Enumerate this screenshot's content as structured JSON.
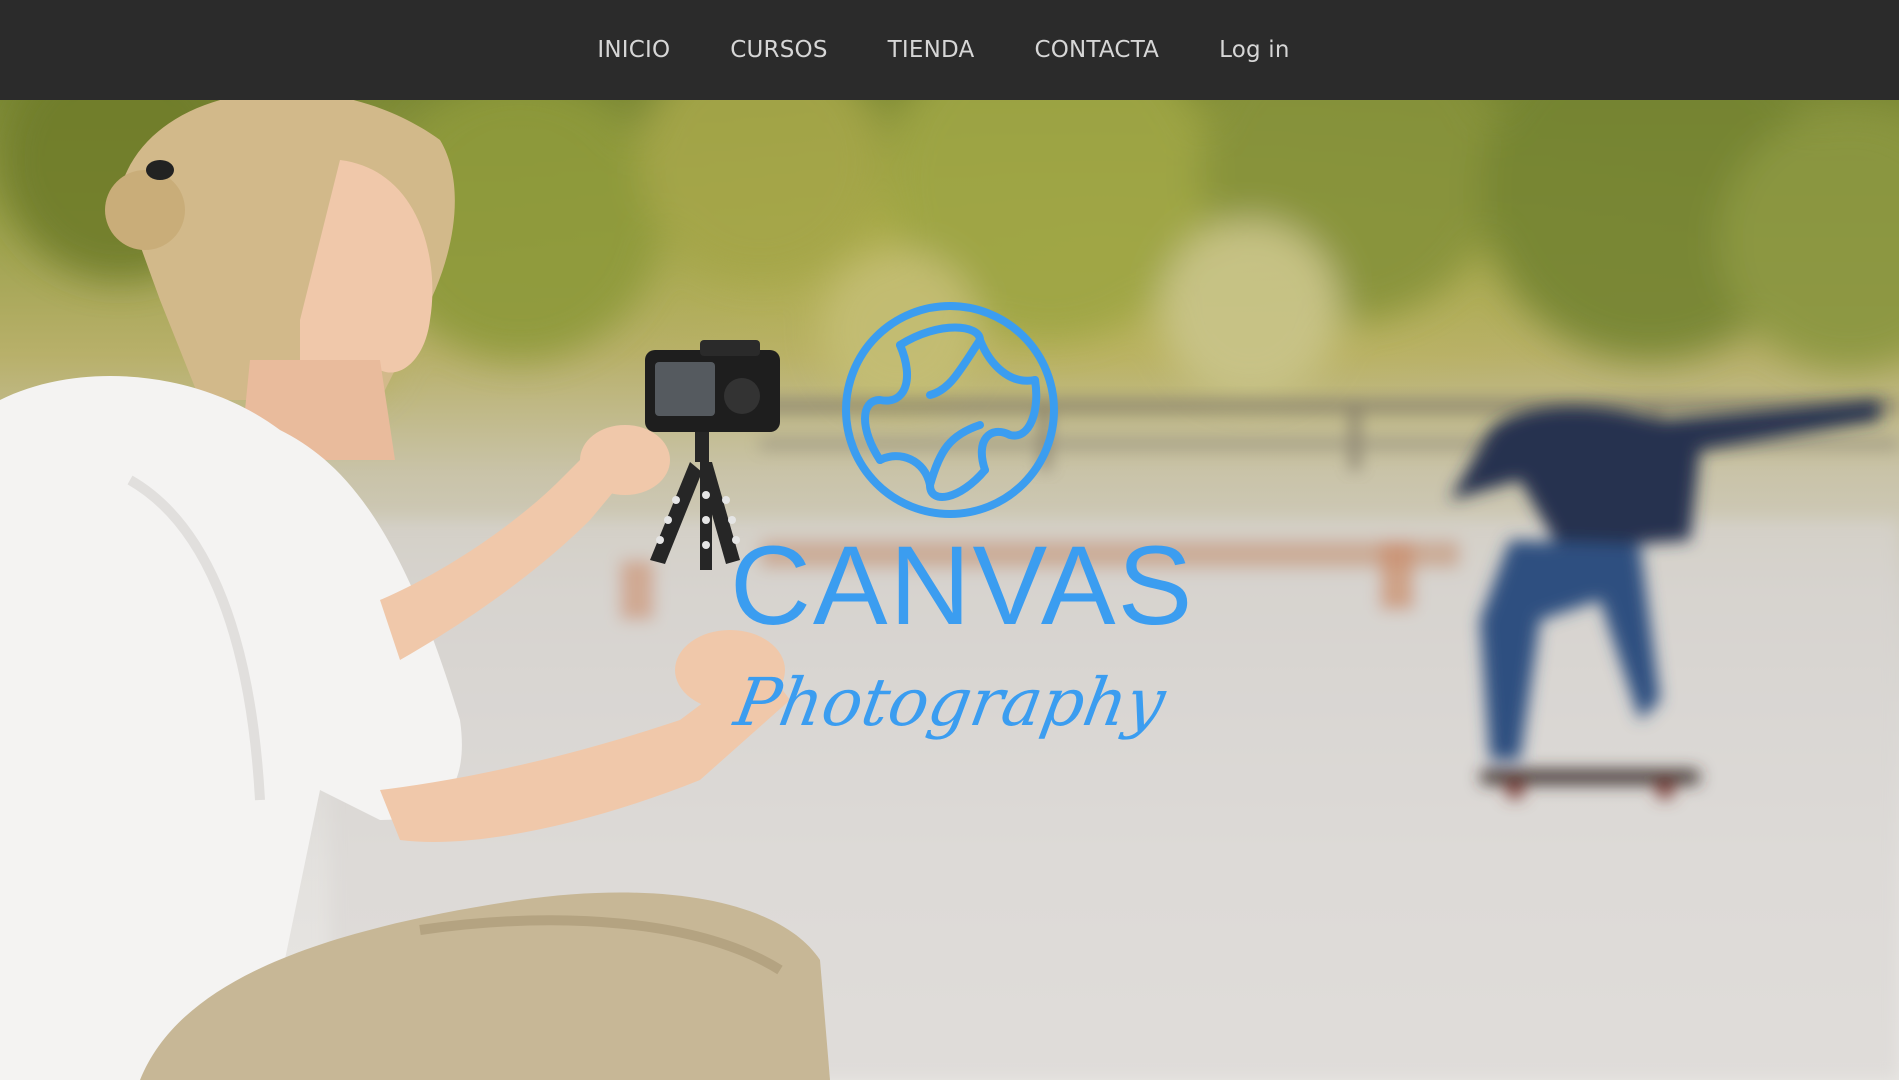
{
  "nav": {
    "items": [
      {
        "label": "INICIO"
      },
      {
        "label": "CURSOS"
      },
      {
        "label": "TIENDA"
      },
      {
        "label": "CONTACTA"
      },
      {
        "label": "Log in"
      }
    ]
  },
  "logo": {
    "title": "CANVAS",
    "subtitle": "Photography",
    "icon": "camera-aperture-icon",
    "color": "#3b9df0"
  },
  "colors": {
    "navbar_bg": "#2b2b2b",
    "nav_text": "#d6d6d6",
    "accent": "#3b9df0"
  }
}
